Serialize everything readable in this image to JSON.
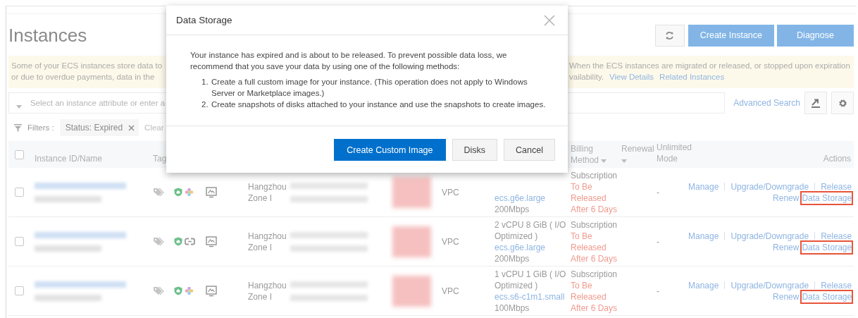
{
  "page": {
    "title": "Instances"
  },
  "toolbar": {
    "buttons": [
      {
        "kind": "refresh"
      },
      {
        "kind": "primary",
        "label": "Create Instance"
      },
      {
        "kind": "primary",
        "label": "Diagnose"
      }
    ]
  },
  "notice": {
    "left_lines": [
      "Some of your ECS instances store data to",
      "or due to overdue payments, data in the"
    ],
    "right_lines": [
      "When the ECS instances are migrated or released, or stopped upon expiration",
      "vailability."
    ],
    "links": [
      "View Details",
      "Related Instances"
    ]
  },
  "search": {
    "placeholder": "Select an instance attribute or enter a",
    "advanced_link": "Advanced Search"
  },
  "filters": {
    "label": "Filters :",
    "tags": [
      "Status: Expired"
    ],
    "clear": "Clear"
  },
  "table": {
    "all_checked": false,
    "columns": [
      {
        "label": "Instance ID/Name",
        "dropdown": false
      },
      {
        "label": "Tag",
        "dropdown": false
      },
      {
        "label": "Billing Method",
        "dropdown": true
      },
      {
        "label": "Renewal",
        "dropdown": true
      },
      {
        "label": "Unlimited Mode",
        "dropdown": false
      },
      {
        "label": "Actions",
        "dropdown": false
      }
    ],
    "rows": [
      {
        "checked": false,
        "feature_icons": [
          {
            "kind": "security"
          },
          {
            "kind": "cluster"
          }
        ],
        "zone": "Hangzhou Zone I",
        "network": "VPC",
        "instance_type": "ecs.g6e.large",
        "bandwidth": "200Mbps",
        "billing": "Subscription",
        "status": "To Be Released After 6 Days",
        "unlimited": "-",
        "actions": [
          "Manage",
          "Upgrade/Downgrade",
          "Release"
        ],
        "secondary_actions": [
          {
            "label": "Renew",
            "highlighted": false
          },
          {
            "label": "Data Storage",
            "highlighted": true
          }
        ]
      },
      {
        "checked": false,
        "feature_icons": [
          {
            "kind": "security"
          },
          {
            "kind": "link"
          }
        ],
        "zone": "Hangzhou Zone I",
        "network": "VPC",
        "spec": "2 vCPU 8 GiB ( I/O Optimized )",
        "instance_type": "ecs.g6e.large",
        "bandwidth": "200Mbps",
        "billing": "Subscription",
        "status": "To Be Released After 6 Days",
        "unlimited": "-",
        "actions": [
          "Manage",
          "Upgrade/Downgrade",
          "Release"
        ],
        "secondary_actions": [
          {
            "label": "Renew",
            "highlighted": false
          },
          {
            "label": "Data Storage",
            "highlighted": true
          }
        ]
      },
      {
        "checked": false,
        "feature_icons": [
          {
            "kind": "security"
          },
          {
            "kind": "cluster"
          }
        ],
        "zone": "Hangzhou Zone I",
        "network": "VPC",
        "spec": "1 vCPU 1 GiB ( I/O Optimized )",
        "instance_type": "ecs.s6-c1m1.small",
        "bandwidth": "100Mbps",
        "billing": "Subscription",
        "status": "To Be Released After 6 Days",
        "unlimited": "-",
        "actions": [
          "Manage",
          "Upgrade/Downgrade",
          "Release"
        ],
        "secondary_actions": [
          {
            "label": "Renew",
            "highlighted": false
          },
          {
            "label": "Data Storage",
            "highlighted": true
          }
        ]
      }
    ]
  },
  "dialog": {
    "title": "Data Storage",
    "message": "Your instance has expired and is about to be released. To prevent possible data loss, we recommend that you save your data by using one of the following methods:",
    "steps": [
      {
        "number": "1.",
        "text": "Create a full custom image for your instance. (This operation does not apply to Windows Server or Marketplace images.)"
      },
      {
        "number": "2.",
        "text": "Create snapshots of disks attached to your instance and use the snapshots to create images."
      }
    ],
    "buttons": [
      {
        "kind": "primary",
        "label": "Create Custom Image"
      },
      {
        "kind": "default",
        "label": "Disks"
      },
      {
        "kind": "default",
        "label": "Cancel"
      }
    ]
  }
}
